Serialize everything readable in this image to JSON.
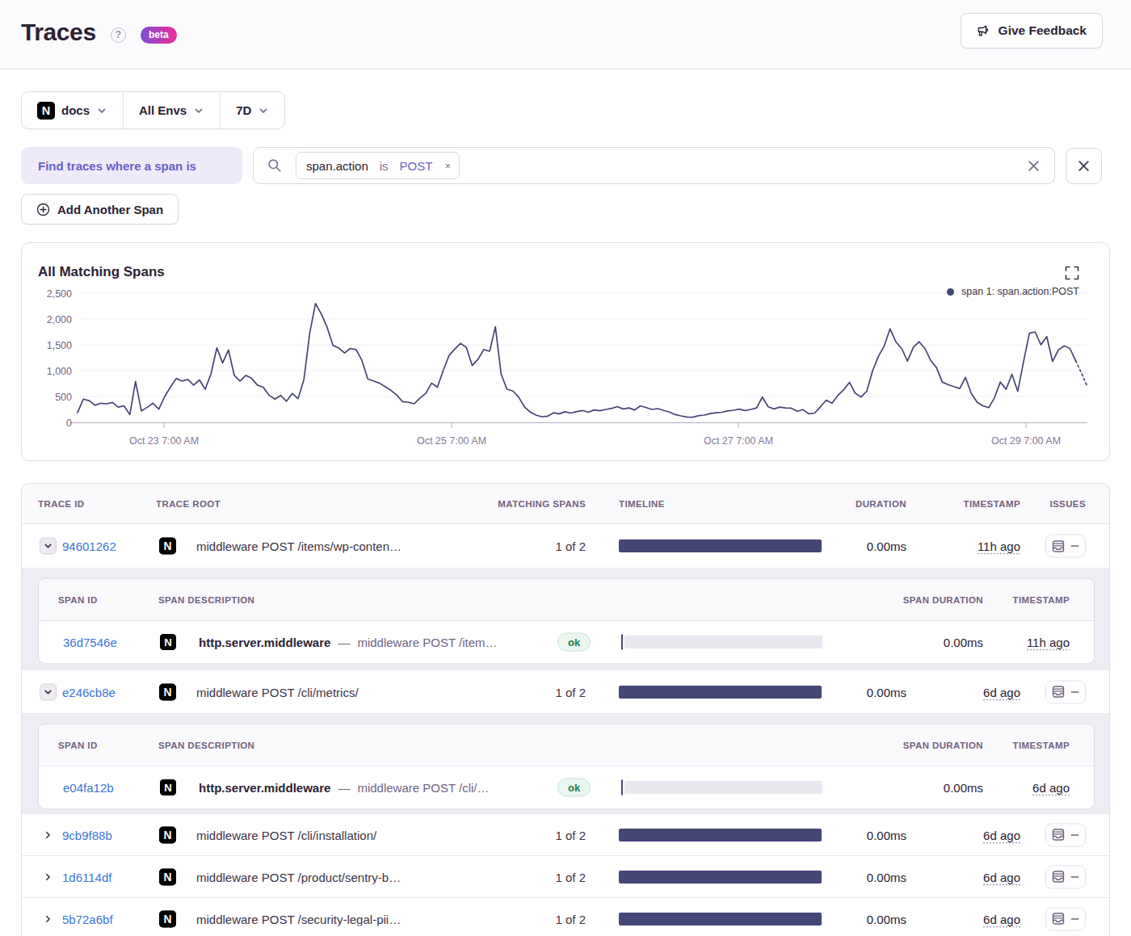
{
  "page": {
    "title": "Traces",
    "help_icon": "?",
    "beta_badge": "beta",
    "feedback_button": "Give Feedback"
  },
  "filters": {
    "project": {
      "name": "docs",
      "logo": "N"
    },
    "environment": "All Envs",
    "period": "7D"
  },
  "span_query": {
    "label": "Find traces where a span is",
    "token": {
      "key": "span.action",
      "operator": "is",
      "value": "POST",
      "remove": "×"
    },
    "add_button": "Add Another Span"
  },
  "chart_data": {
    "type": "line",
    "title": "All Matching Spans",
    "legend": [
      {
        "label": "span 1: span.action:POST",
        "color": "#444674"
      }
    ],
    "legend_position": "top-right",
    "grid": "faint-horizontal",
    "ylim": [
      0,
      2500
    ],
    "y_ticks": [
      "0",
      "500",
      "1,000",
      "1,500",
      "2,000",
      "2,500"
    ],
    "x_ticks": [
      "Oct 23 7:00 AM",
      "Oct 25 7:00 AM",
      "Oct 27 7:00 AM",
      "Oct 29 7:00 AM"
    ],
    "x_tick_fractions": [
      0.0856,
      0.3704,
      0.6544,
      0.9392
    ],
    "series": [
      {
        "name": "span 1: span.action:POST",
        "color": "#444674",
        "dashed_tail_points": 3,
        "values": [
          190,
          450,
          420,
          330,
          370,
          360,
          385,
          295,
          320,
          150,
          790,
          220,
          290,
          370,
          255,
          500,
          680,
          850,
          800,
          830,
          720,
          820,
          640,
          940,
          1440,
          1150,
          1400,
          910,
          800,
          910,
          850,
          720,
          680,
          525,
          450,
          520,
          410,
          560,
          460,
          830,
          1730,
          2300,
          2100,
          1840,
          1490,
          1440,
          1340,
          1430,
          1410,
          1200,
          840,
          800,
          760,
          690,
          620,
          530,
          400,
          390,
          360,
          470,
          560,
          760,
          680,
          1000,
          1290,
          1420,
          1530,
          1450,
          1100,
          1220,
          1410,
          1375,
          1850,
          930,
          640,
          610,
          490,
          300,
          200,
          140,
          110,
          120,
          185,
          165,
          205,
          180,
          210,
          230,
          195,
          240,
          225,
          250,
          270,
          305,
          260,
          280,
          240,
          320,
          285,
          250,
          265,
          230,
          200,
          150,
          125,
          105,
          100,
          130,
          140,
          170,
          185,
          195,
          220,
          235,
          255,
          230,
          250,
          280,
          490,
          300,
          260,
          295,
          280,
          275,
          215,
          245,
          165,
          180,
          300,
          430,
          370,
          520,
          630,
          775,
          565,
          490,
          605,
          1000,
          1280,
          1480,
          1810,
          1560,
          1430,
          1185,
          1450,
          1560,
          1430,
          1200,
          1061,
          780,
          730,
          690,
          655,
          870,
          560,
          390,
          320,
          285,
          480,
          780,
          640,
          930,
          600,
          1175,
          1725,
          1750,
          1500,
          1660,
          1180,
          1400,
          1480,
          1430,
          1190,
          950,
          690
        ]
      }
    ]
  },
  "table": {
    "headers": {
      "trace_id": "TRACE ID",
      "trace_root": "TRACE ROOT",
      "matching_spans": "MATCHING SPANS",
      "timeline": "TIMELINE",
      "duration": "DURATION",
      "timestamp": "TIMESTAMP",
      "issues": "ISSUES"
    },
    "sub_headers": {
      "span_id": "SPAN ID",
      "span_description": "SPAN DESCRIPTION",
      "span_duration": "SPAN DURATION",
      "timestamp": "TIMESTAMP"
    },
    "rows": [
      {
        "trace_id": "94601262",
        "expanded": true,
        "trace_root": "middleware POST /items/wp-conten…",
        "matching_spans": "1 of 2",
        "duration": "0.00ms",
        "timestamp": "11h ago",
        "issues": "none",
        "spans": [
          {
            "span_id": "36d7546e",
            "op": "http.server.middleware",
            "separator": "—",
            "description": "middleware POST /item…",
            "status": "ok",
            "span_duration": "0.00ms",
            "timestamp": "11h ago"
          }
        ]
      },
      {
        "trace_id": "e246cb8e",
        "expanded": true,
        "trace_root": "middleware POST /cli/metrics/",
        "matching_spans": "1 of 2",
        "duration": "0.00ms",
        "timestamp": "6d ago",
        "issues": "none",
        "spans": [
          {
            "span_id": "e04fa12b",
            "op": "http.server.middleware",
            "separator": "—",
            "description": "middleware POST /cli/…",
            "status": "ok",
            "span_duration": "0.00ms",
            "timestamp": "6d ago"
          }
        ]
      },
      {
        "trace_id": "9cb9f88b",
        "expanded": false,
        "trace_root": "middleware POST /cli/installation/",
        "matching_spans": "1 of 2",
        "duration": "0.00ms",
        "timestamp": "6d ago",
        "issues": "none",
        "spans": []
      },
      {
        "trace_id": "1d6114df",
        "expanded": false,
        "trace_root": "middleware POST /product/sentry-b…",
        "matching_spans": "1 of 2",
        "duration": "0.00ms",
        "timestamp": "6d ago",
        "issues": "none",
        "spans": []
      },
      {
        "trace_id": "5b72a6bf",
        "expanded": false,
        "trace_root": "middleware POST /security-legal-pii…",
        "matching_spans": "1 of 2",
        "duration": "0.00ms",
        "timestamp": "6d ago",
        "issues": "none",
        "spans": []
      }
    ]
  },
  "icons": {
    "help-icon": "?",
    "megaphone-icon": "megaphone outline",
    "chevron-down-icon": "⌄ chevron",
    "chevron-right-icon": "› chevron",
    "search-icon": "🔍 magnifier",
    "close-icon": "×",
    "plus-circle-icon": "⊕",
    "fullscreen-icon": "corner brackets",
    "issues-inbox-icon": "inbox tray",
    "minus-icon": "−",
    "legend-series-dot": "●",
    "nextjs-project-icon": "N in black rounded square"
  },
  "colors": {
    "accent_purple": "#6C5FC7",
    "chart_line": "#444674",
    "link_blue": "#3d74db",
    "ok_green": "#187d49",
    "beta_gradient_start": "#7e4dd6",
    "beta_gradient_end": "#ef2b9c"
  }
}
